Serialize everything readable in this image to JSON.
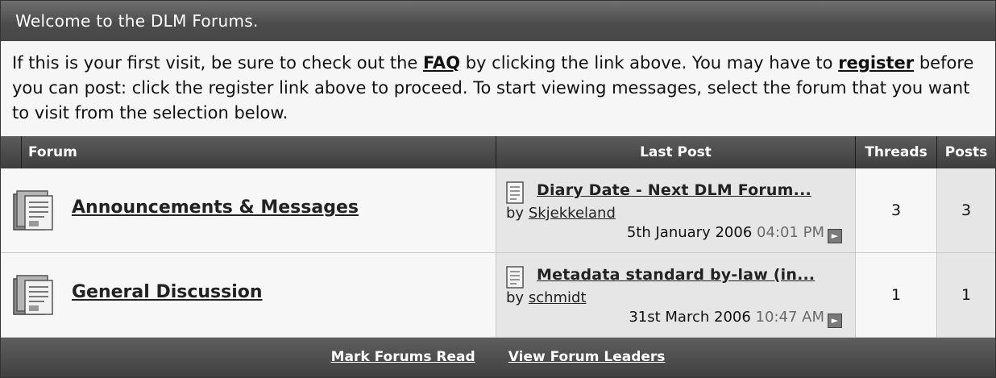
{
  "welcome": {
    "title": "Welcome to the DLM Forums.",
    "text_1": "If this is your first visit, be sure to check out the ",
    "faq_link": "FAQ",
    "text_2": " by clicking the link above. You may have to ",
    "register_link": "register",
    "text_3": " before you can post: click the register link above to proceed. To start viewing messages, select the forum that you want to visit from the selection below."
  },
  "columns": {
    "forum": "Forum",
    "last_post": "Last Post",
    "threads": "Threads",
    "posts": "Posts"
  },
  "forums": [
    {
      "name": "Announcements & Messages",
      "icon": "forum-folder-icon",
      "last_post": {
        "title": "Diary Date - Next DLM Forum...",
        "by_label": "by",
        "author": "Skjekkeland",
        "date": "5th January 2006",
        "time": "04:01 PM"
      },
      "threads": "3",
      "posts": "3"
    },
    {
      "name": "General Discussion",
      "icon": "forum-folder-icon",
      "last_post": {
        "title": "Metadata standard by-law (in...",
        "by_label": "by",
        "author": "schmidt",
        "date": "31st March 2006",
        "time": "10:47 AM"
      },
      "threads": "1",
      "posts": "1"
    }
  ],
  "footer": {
    "mark_read": "Mark Forums Read",
    "view_leaders": "View Forum Leaders"
  }
}
